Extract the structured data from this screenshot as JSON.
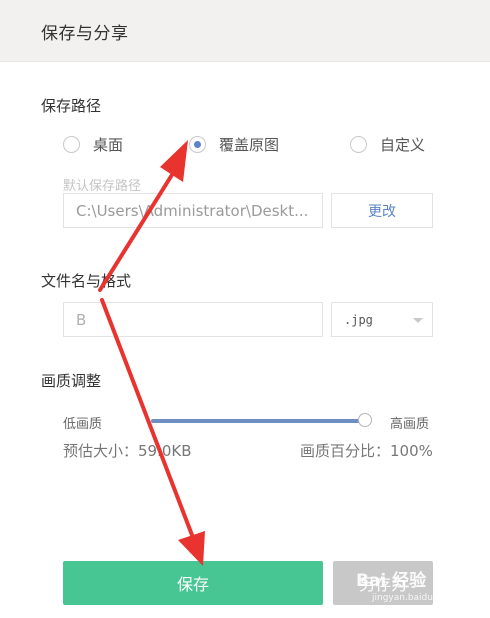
{
  "header": {
    "title": "保存与分享"
  },
  "save_path": {
    "title": "保存路径",
    "options": [
      {
        "label": "桌面",
        "checked": false
      },
      {
        "label": "覆盖原图",
        "checked": true
      },
      {
        "label": "自定义",
        "checked": false
      }
    ],
    "hint": "默认保存路径",
    "path_value": "C:\\Users\\Administrator\\Deskt...",
    "change_label": "更改"
  },
  "file": {
    "title": "文件名与格式",
    "name_value": "B",
    "format_value": ".jpg"
  },
  "quality": {
    "title": "画质调整",
    "low_label": "低画质",
    "high_label": "高画质",
    "percent": 100,
    "size_text": "预估大小：59.0KB",
    "percent_text": "画质百分比：100%"
  },
  "buttons": {
    "save_label": "保存",
    "save_as_label": "另存为"
  },
  "watermark": {
    "text": "Bai 经验",
    "sub": "jingyan.baidu.com"
  },
  "colors": {
    "accent": "#47c693",
    "radio_accent": "#5b84c8",
    "annotation": "#e8332e"
  }
}
